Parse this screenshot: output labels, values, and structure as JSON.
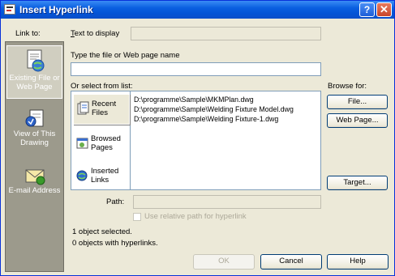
{
  "window": {
    "title": "Insert Hyperlink",
    "help_glyph": "?",
    "close_glyph": "✕"
  },
  "link_to": {
    "label": "Link to:",
    "items": [
      {
        "label_line1": "Existing File or",
        "label_line2": "Web Page",
        "icon": "document-globe-icon",
        "selected": true
      },
      {
        "label_line1": "View of This",
        "label_line2": "Drawing",
        "icon": "view-drawing-icon",
        "selected": false
      },
      {
        "label_line1": "E-mail Address",
        "label_line2": "",
        "icon": "email-icon",
        "selected": false
      }
    ]
  },
  "text_to_display": {
    "label": "Text to display",
    "value": ""
  },
  "filename": {
    "label": "Type the file or Web page name",
    "value": ""
  },
  "select_from_list": {
    "label": "Or select from list:"
  },
  "browse_for": {
    "label": "Browse for:",
    "file_button": "File...",
    "webpage_button": "Web Page...",
    "target_button": "Target..."
  },
  "list_categories": [
    {
      "label_line1": "Recent",
      "label_line2": "Files",
      "icon": "recent-files-icon",
      "selected": true
    },
    {
      "label_line1": "Browsed",
      "label_line2": "Pages",
      "icon": "browsed-pages-icon",
      "selected": false
    },
    {
      "label_line1": "Inserted",
      "label_line2": "Links",
      "icon": "inserted-links-icon",
      "selected": false
    }
  ],
  "files": [
    "D:\\programme\\Sample\\MKMPlan.dwg",
    "D:\\programme\\Sample\\Welding Fixture Model.dwg",
    "D:\\programme\\Sample\\Welding Fixture-1.dwg"
  ],
  "path": {
    "label": "Path:",
    "value": ""
  },
  "relative_path": {
    "label": "Use relative path for hyperlink",
    "checked": false,
    "enabled": false
  },
  "status": {
    "objects_selected": "1 object selected.",
    "objects_with_hyperlinks": "0 objects with hyperlinks."
  },
  "buttons": {
    "ok": "OK",
    "cancel": "Cancel",
    "help": "Help"
  }
}
